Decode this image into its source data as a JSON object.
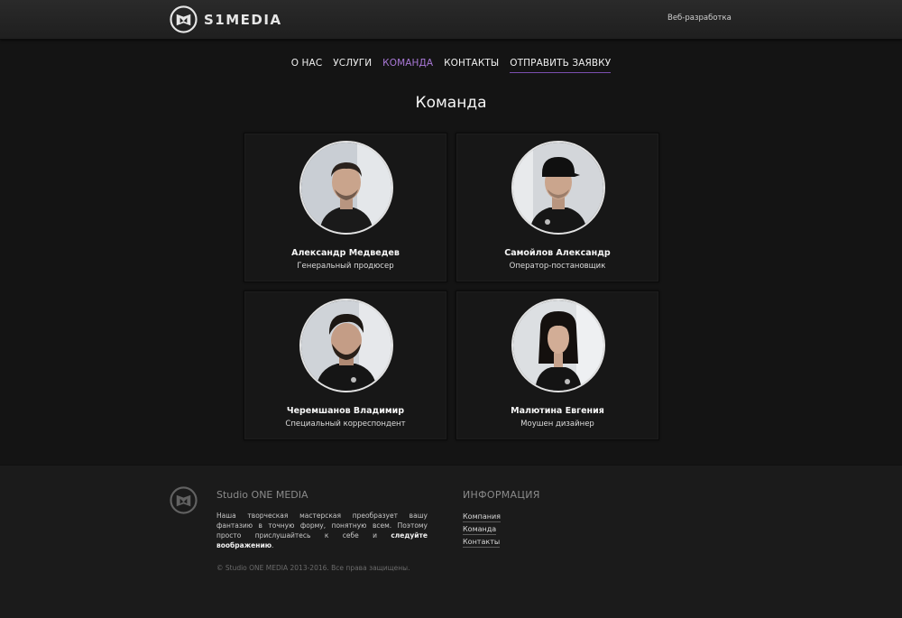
{
  "header": {
    "brand": "S1MEDIA",
    "link": "Веб-разработка",
    "logo_icon": "s1-logo-icon"
  },
  "nav": {
    "items": [
      {
        "label": "О НАС"
      },
      {
        "label": "УСЛУГИ"
      },
      {
        "label": "КОМАНДА"
      },
      {
        "label": "КОНТАКТЫ"
      },
      {
        "label": "ОТПРАВИТЬ ЗАЯВКУ"
      }
    ],
    "active_index": 2
  },
  "page": {
    "title": "Команда"
  },
  "team": [
    {
      "name": "Александр Медведев",
      "role": "Генеральный продюсер"
    },
    {
      "name": "Самойлов Александр",
      "role": "Оператор-постановщик"
    },
    {
      "name": "Черемшанов Владимир",
      "role": "Специальный корреспондент"
    },
    {
      "name": "Малютина Евгения",
      "role": "Моушен дизайнер"
    }
  ],
  "footer": {
    "title": "Studio ONE MEDIA",
    "text": "Наша творческая мастерская преобразует вашу фантазию в точную форму, понятную всем. Поэтому просто прислушайтесь к себе и",
    "text_bold": "следуйте воображению",
    "text_end": ".",
    "info_title": "ИНФОРМАЦИЯ",
    "links": [
      {
        "label": "Компания"
      },
      {
        "label": "Команда"
      },
      {
        "label": "Контакты"
      }
    ],
    "copyright": "© Studio ONE MEDIA 2013-2016. Все права защищены."
  },
  "colors": {
    "accent": "#a978d6",
    "background": "#141414",
    "footer_bg": "#1b1b1b"
  }
}
